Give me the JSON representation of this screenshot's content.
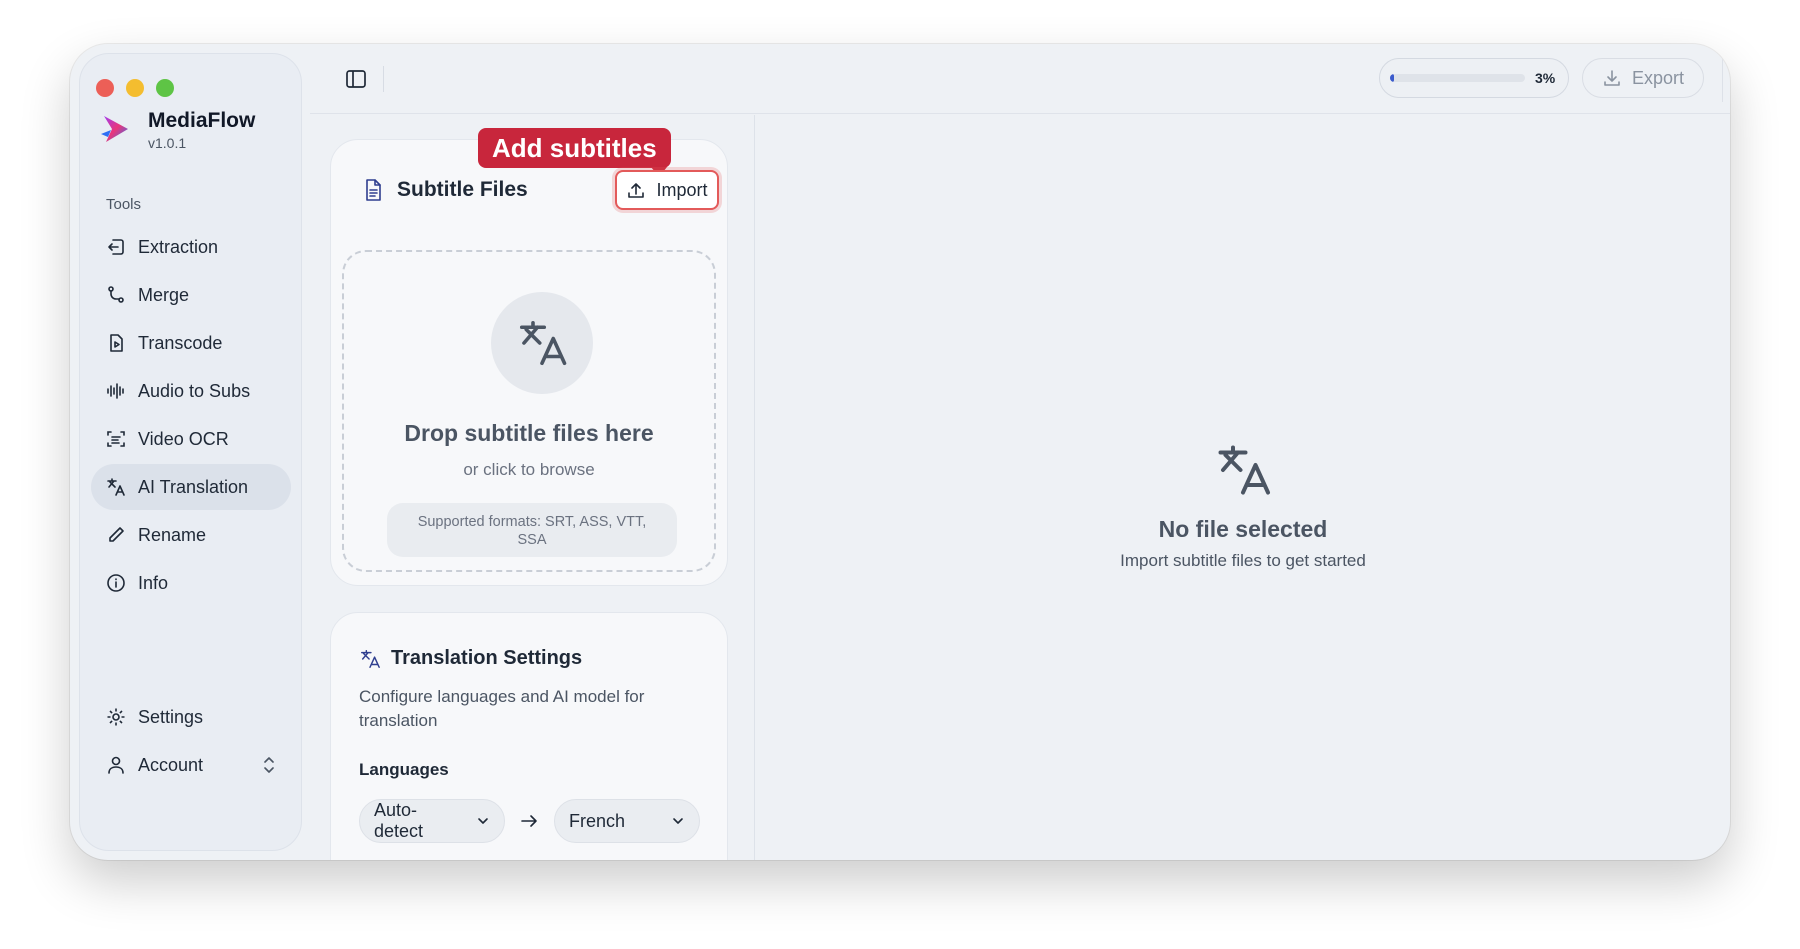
{
  "app": {
    "name": "MediaFlow",
    "version": "v1.0.1"
  },
  "sidebar": {
    "section_label": "Tools",
    "items": [
      {
        "label": "Extraction",
        "icon": "extraction-icon"
      },
      {
        "label": "Merge",
        "icon": "merge-icon"
      },
      {
        "label": "Transcode",
        "icon": "transcode-icon"
      },
      {
        "label": "Audio to Subs",
        "icon": "audio-wave-icon"
      },
      {
        "label": "Video OCR",
        "icon": "scan-text-icon"
      },
      {
        "label": "AI Translation",
        "icon": "translate-icon",
        "active": true
      },
      {
        "label": "Rename",
        "icon": "pencil-icon"
      },
      {
        "label": "Info",
        "icon": "info-icon"
      }
    ],
    "bottom": [
      {
        "label": "Settings",
        "icon": "gear-icon"
      },
      {
        "label": "Account",
        "icon": "user-icon"
      }
    ]
  },
  "topbar": {
    "progress_text": "3%",
    "progress_value": 0.03,
    "export_label": "Export"
  },
  "subtitle_card": {
    "title": "Subtitle Files",
    "import_label": "Import",
    "tooltip": "Add subtitles",
    "drop_title": "Drop subtitle files here",
    "drop_sub": "or click to browse",
    "formats": "Supported formats: SRT, ASS, VTT, SSA"
  },
  "settings_card": {
    "title": "Translation Settings",
    "description": "Configure languages and AI model for translation",
    "languages_label": "Languages",
    "source_language": "Auto-detect",
    "target_language": "French"
  },
  "empty_state": {
    "title": "No file selected",
    "subtitle": "Import subtitle files to get started"
  },
  "colors": {
    "accent": "#3b5bcc",
    "tooltip": "#c8263c",
    "highlight": "#e35a5a"
  }
}
